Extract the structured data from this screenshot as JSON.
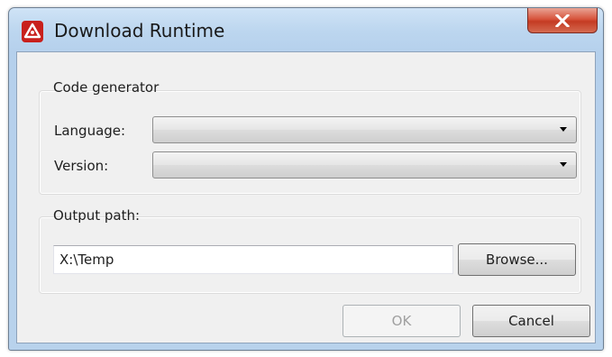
{
  "window": {
    "title": "Download Runtime"
  },
  "code_generator": {
    "group_label": "Code generator",
    "language_label": "Language:",
    "language_value": "",
    "version_label": "Version:",
    "version_value": ""
  },
  "output": {
    "group_label": "Output path:",
    "path_value": "X:\\Temp",
    "browse_label": "Browse..."
  },
  "dialog_buttons": {
    "ok_label": "OK",
    "cancel_label": "Cancel"
  },
  "colors": {
    "close_button": "#c43b23",
    "app_icon": "#c8201c"
  },
  "icons": {
    "app": "app-logo-icon",
    "close": "close-icon",
    "dropdown": "chevron-down-icon"
  }
}
